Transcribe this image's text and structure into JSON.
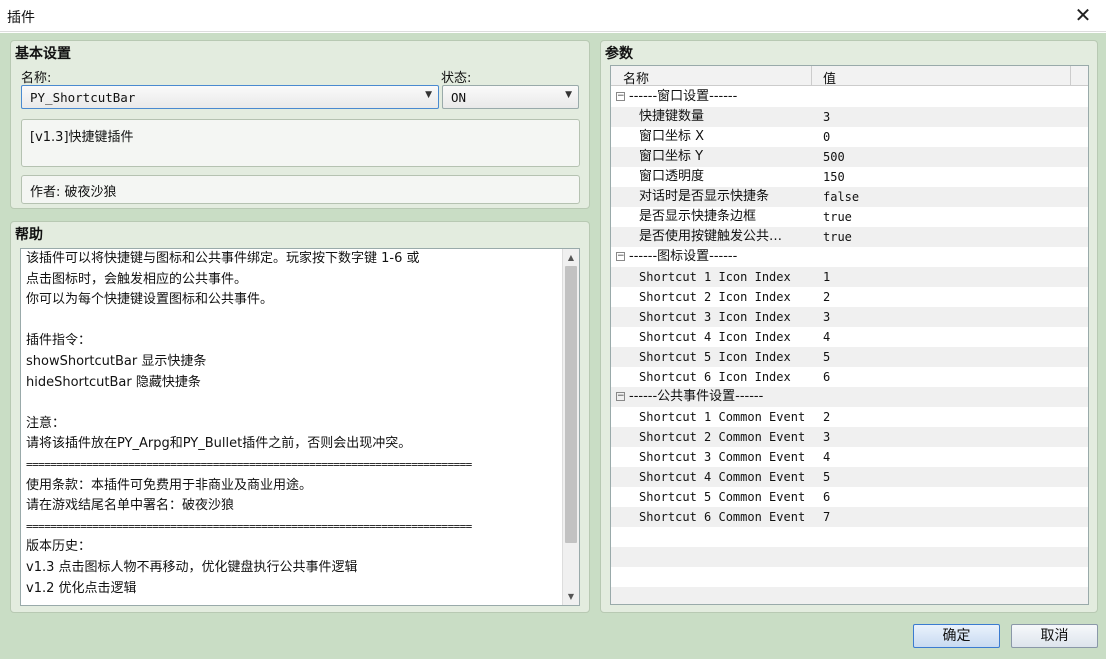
{
  "window": {
    "title": "插件",
    "close_glyph": "✕"
  },
  "basic": {
    "title": "基本设置",
    "name_label": "名称:",
    "name_value": "PY_ShortcutBar",
    "status_label": "状态:",
    "status_value": "ON",
    "description": "[v1.3]快捷键插件",
    "author": "作者: 破夜沙狼"
  },
  "help": {
    "title": "帮助",
    "lines": [
      "该插件可以将快捷键与图标和公共事件绑定。玩家按下数字键 1-6 或",
      "点击图标时，会触发相应的公共事件。",
      "你可以为每个快捷键设置图标和公共事件。",
      "",
      "插件指令：",
      "showShortcutBar 显示快捷条",
      "hideShortcutBar 隐藏快捷条",
      "",
      "注意：",
      "请将该插件放在PY_Arpg和PY_Bullet插件之前，否则会出现冲突。",
      "==========================================================================",
      "使用条款：本插件可免费用于非商业及商业用途。",
      "请在游戏结尾名单中署名：破夜沙狼",
      "==========================================================================",
      "版本历史：",
      "v1.3 点击图标人物不再移动，优化键盘执行公共事件逻辑",
      "v1.2 优化点击逻辑"
    ]
  },
  "params": {
    "title": "参数",
    "col_name": "名称",
    "col_value": "值",
    "rows": [
      {
        "type": "group",
        "name": "------窗口设置------",
        "value": ""
      },
      {
        "type": "item",
        "name": "快捷键数量",
        "value": "3"
      },
      {
        "type": "item",
        "name": "窗口坐标 X",
        "value": "0"
      },
      {
        "type": "item",
        "name": "窗口坐标 Y",
        "value": "500"
      },
      {
        "type": "item",
        "name": "窗口透明度",
        "value": "150"
      },
      {
        "type": "item",
        "name": "对话时是否显示快捷条",
        "value": "false"
      },
      {
        "type": "item",
        "name": "是否显示快捷条边框",
        "value": "true"
      },
      {
        "type": "item",
        "name": "是否使用按键触发公共…",
        "value": "true"
      },
      {
        "type": "group",
        "name": "------图标设置------",
        "value": ""
      },
      {
        "type": "item",
        "name": "Shortcut 1 Icon Index",
        "value": "1"
      },
      {
        "type": "item",
        "name": "Shortcut 2 Icon Index",
        "value": "2"
      },
      {
        "type": "item",
        "name": "Shortcut 3 Icon Index",
        "value": "3"
      },
      {
        "type": "item",
        "name": "Shortcut 4 Icon Index",
        "value": "4"
      },
      {
        "type": "item",
        "name": "Shortcut 5 Icon Index",
        "value": "5"
      },
      {
        "type": "item",
        "name": "Shortcut 6 Icon Index",
        "value": "6"
      },
      {
        "type": "group",
        "name": "------公共事件设置------",
        "value": ""
      },
      {
        "type": "item",
        "name": "Shortcut 1 Common Event",
        "value": "2"
      },
      {
        "type": "item",
        "name": "Shortcut 2 Common Event",
        "value": "3"
      },
      {
        "type": "item",
        "name": "Shortcut 3 Common Event",
        "value": "4"
      },
      {
        "type": "item",
        "name": "Shortcut 4 Common Event",
        "value": "5"
      },
      {
        "type": "item",
        "name": "Shortcut 5 Common Event",
        "value": "6"
      },
      {
        "type": "item",
        "name": "Shortcut 6 Common Event",
        "value": "7"
      }
    ]
  },
  "buttons": {
    "ok": "确定",
    "cancel": "取消"
  }
}
